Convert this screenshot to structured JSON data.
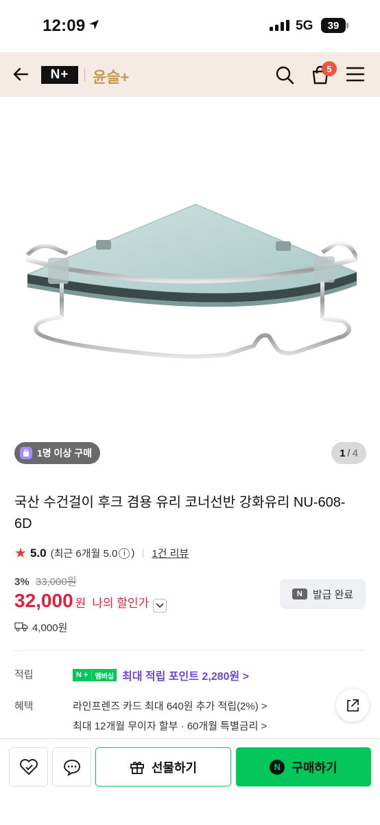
{
  "status_bar": {
    "time": "12:09",
    "network": "5G",
    "battery": "39"
  },
  "header": {
    "logo": "N+",
    "store_name": "윤슬+",
    "cart_count": "5"
  },
  "gallery": {
    "purchase_chip": "1명 이상 구매",
    "page_current": "1",
    "page_sep": "/",
    "page_total": "4"
  },
  "product": {
    "title": "국산 수건걸이 후크 겸용 유리 코너선반 강화유리 NU-608-6D",
    "rating": "5.0",
    "rating_recent": "(최근 6개월 5.0",
    "rating_recent_close": ")",
    "review_link": "1건 리뷰",
    "discount_pct": "3%",
    "original_price": "33,000원",
    "price": "32,000",
    "price_unit": "원",
    "my_discount": "나의 할인가",
    "coupon_label": "발급 완료",
    "shipping": "4,000원"
  },
  "benefits": {
    "points_label": "적립",
    "membership_badge_a": "N +",
    "membership_badge_b": "멤버십",
    "points_text": "최대 적립 포인트 2,280원 >",
    "benefit_label": "혜택",
    "benefit_line1": "라인프렌즈 카드 최대 640원 추가 적립(2%) >",
    "benefit_line2": "최대 12개월 무이자 할부 · 60개월 특별금리 >"
  },
  "bottom_bar": {
    "gift_label": "선물하기",
    "buy_label": "구매하기",
    "buy_badge": "N"
  },
  "colors": {
    "accent_green": "#03c75a",
    "price_red": "#e3203e",
    "points_purple": "#6b46d6",
    "header_bg": "#f4ece4"
  }
}
